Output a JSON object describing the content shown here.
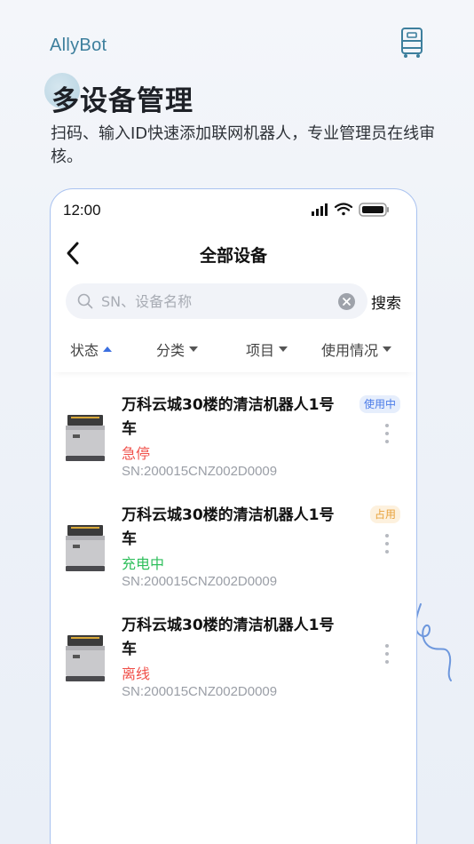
{
  "brand": {
    "name": "AllyBot",
    "icon": "robot-outline-icon"
  },
  "hero": {
    "title": "多设备管理",
    "subtitle": "扫码、输入ID快速添加联网机器人，专业管理员在线审核。"
  },
  "phone": {
    "status_bar": {
      "time": "12:00",
      "icons": [
        "signal-icon",
        "wifi-icon",
        "battery-icon"
      ]
    },
    "nav": {
      "title": "全部设备",
      "back_icon": "chevron-left-icon"
    },
    "search": {
      "placeholder": "SN、设备名称",
      "value": "",
      "button": "搜索"
    },
    "filters": [
      {
        "label": "状态",
        "active": true
      },
      {
        "label": "分类",
        "active": false
      },
      {
        "label": "项目",
        "active": false
      },
      {
        "label": "使用情况",
        "active": false
      }
    ],
    "devices": [
      {
        "name": "万科云城30楼的清洁机器人1号车",
        "status": "急停",
        "status_color": "#f0504a",
        "sn": "SN:200015CNZ002D0009",
        "badge": "使用中",
        "badge_color": "#4a7be8",
        "badge_bg": "#e6eefc"
      },
      {
        "name": "万科云城30楼的清洁机器人1号车",
        "status": "充电中",
        "status_color": "#2fbf5c",
        "sn": "SN:200015CNZ002D0009",
        "badge": "占用",
        "badge_color": "#e8a23c",
        "badge_bg": "#fdf1de"
      },
      {
        "name": "万科云城30楼的清洁机器人1号车",
        "status": "离线",
        "status_color": "#f0504a",
        "sn": "SN:200015CNZ002D0009",
        "badge": "",
        "badge_color": "",
        "badge_bg": ""
      }
    ]
  },
  "colors": {
    "brand": "#3d7f9d",
    "phone_border": "#a9c2f0",
    "accent": "#3b6fe0"
  }
}
